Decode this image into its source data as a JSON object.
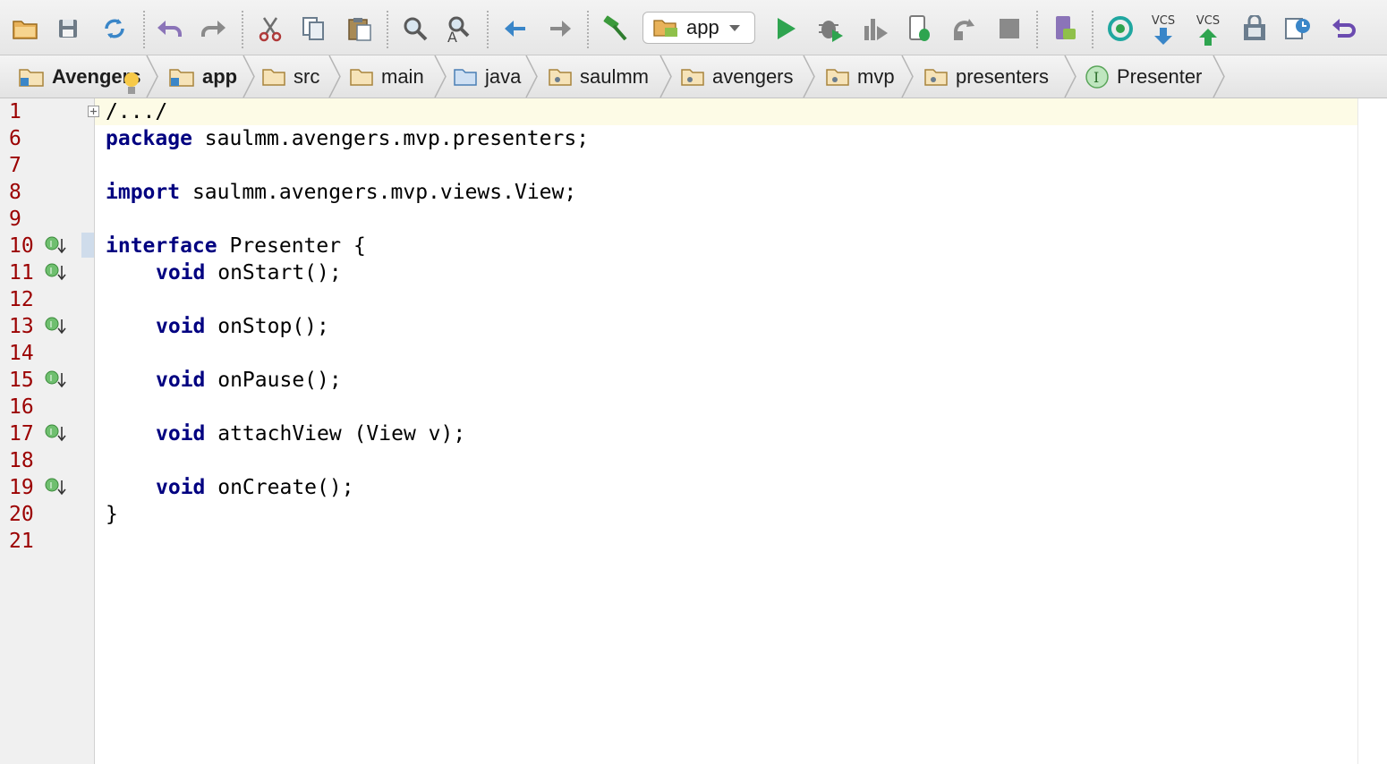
{
  "toolbar": {
    "run_config": "app",
    "vcs_update_label": "VCS",
    "vcs_commit_label": "VCS"
  },
  "breadcrumbs": [
    {
      "label": "Avengers",
      "icon": "module-folder-icon"
    },
    {
      "label": "app",
      "icon": "module-folder-icon"
    },
    {
      "label": "src",
      "icon": "folder-icon"
    },
    {
      "label": "main",
      "icon": "folder-icon"
    },
    {
      "label": "java",
      "icon": "source-folder-icon"
    },
    {
      "label": "saulmm",
      "icon": "package-icon"
    },
    {
      "label": "avengers",
      "icon": "package-icon"
    },
    {
      "label": "mvp",
      "icon": "package-icon"
    },
    {
      "label": "presenters",
      "icon": "package-icon"
    },
    {
      "label": "Presenter",
      "icon": "interface-icon"
    }
  ],
  "editor": {
    "line_numbers": [
      "1",
      "6",
      "7",
      "8",
      "9",
      "10",
      "11",
      "12",
      "13",
      "14",
      "15",
      "16",
      "17",
      "18",
      "19",
      "20",
      "21"
    ],
    "code": {
      "fold": "/.../",
      "package_kw": "package",
      "package_rest": " saulmm.avengers.mvp.presenters;",
      "import_kw": "import",
      "import_rest": " saulmm.avengers.mvp.views.View;",
      "interface_kw": "interface",
      "interface_rest": " Presenter {",
      "m1_kw": "void",
      "m1_rest": " onStart();",
      "m2_kw": "void",
      "m2_rest": " onStop();",
      "m3_kw": "void",
      "m3_rest": " onPause();",
      "m4_kw": "void",
      "m4_rest": " attachView (View v);",
      "m5_kw": "void",
      "m5_rest": " onCreate();",
      "close": "}"
    }
  }
}
